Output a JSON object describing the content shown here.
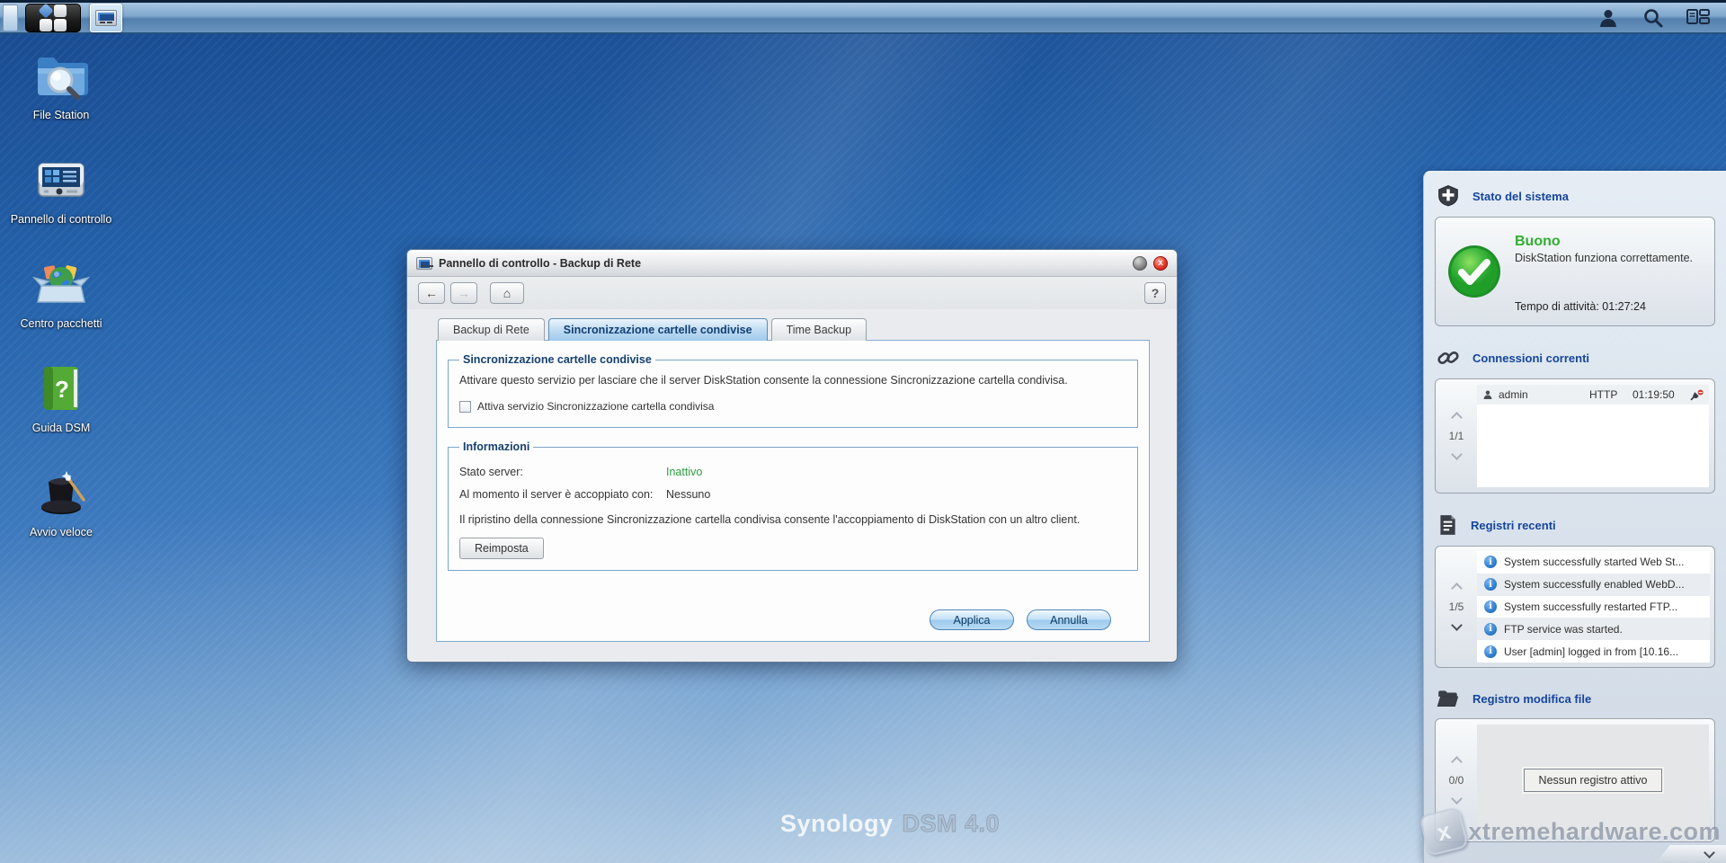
{
  "colors": {
    "accent_blue": "#14459c",
    "status_good_green": "#2fae2f",
    "inactive_green": "#2f9e3f",
    "close_red": "#cc2a21",
    "info_blue": "#2f7fd0",
    "desktop_top": "#17498f",
    "desktop_bottom": "#cbdcec"
  },
  "desktop": {
    "icons": [
      {
        "label": "File Station"
      },
      {
        "label": "Pannello di controllo"
      },
      {
        "label": "Centro pacchetti"
      },
      {
        "label": "Guida DSM"
      },
      {
        "label": "Avvio veloce"
      }
    ],
    "watermark_brand": "Synology",
    "watermark_version": "DSM 4.0",
    "watermark_site": "xtremehardware.com",
    "watermark_site_logo": "x"
  },
  "dialog": {
    "title": "Pannello di controllo - Backup di Rete",
    "close_glyph": "x",
    "back_glyph": "←",
    "forward_glyph": "→",
    "home_glyph": "⌂",
    "help_label": "?",
    "tabs": [
      {
        "label": "Backup di Rete",
        "active": false
      },
      {
        "label": "Sincronizzazione cartelle condivise",
        "active": true
      },
      {
        "label": "Time Backup",
        "active": false
      }
    ],
    "section_sync": {
      "legend": "Sincronizzazione cartelle condivise",
      "description": "Attivare questo servizio per lasciare che il server DiskStation consente la connessione Sincronizzazione cartella condivisa.",
      "checkbox_label": "Attiva servizio Sincronizzazione cartella condivisa",
      "checkbox_checked": false
    },
    "section_info": {
      "legend": "Informazioni",
      "server_status_label": "Stato server:",
      "server_status_value": "Inattivo",
      "paired_label": "Al momento il server è accoppiato con:",
      "paired_value": "Nessuno",
      "note": "Il ripristino della connessione Sincronizzazione cartella condivisa consente l'accoppiamento di DiskStation con un altro client.",
      "reset_button": "Reimposta"
    },
    "apply_button": "Applica",
    "cancel_button": "Annulla"
  },
  "widgets": {
    "system_health": {
      "title": "Stato del sistema",
      "status": "Buono",
      "description": "DiskStation funziona correttamente.",
      "uptime": "Tempo di attività: 01:27:24"
    },
    "current_connections": {
      "title": "Connessioni correnti",
      "pager": "1/1",
      "rows": [
        {
          "user": "admin",
          "protocol": "HTTP",
          "time": "01:19:50"
        }
      ]
    },
    "recent_logs": {
      "title": "Registri recenti",
      "pager": "1/5",
      "info_glyph": "i",
      "items": [
        "System successfully started Web St...",
        "System successfully enabled WebD...",
        "System successfully restarted FTP...",
        "FTP service was started.",
        "User [admin] logged in from [10.16..."
      ]
    },
    "file_change_log": {
      "title": "Registro modifica file",
      "pager": "0/0",
      "empty_message": "Nessun registro attivo"
    }
  }
}
